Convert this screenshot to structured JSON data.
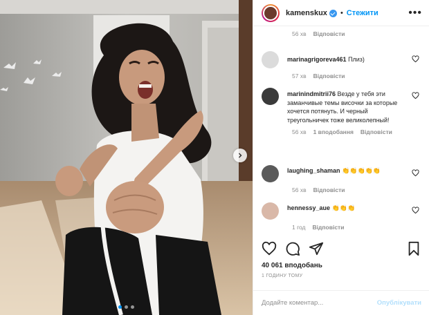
{
  "header": {
    "username": "kamenskux",
    "separator": "•",
    "follow_label": "Стежити",
    "more_label": "•••"
  },
  "top_meta": {
    "time": "56 хв",
    "reply": "Відповісти"
  },
  "comments": [
    {
      "user": "marinagrigoreva461",
      "text": "Плиз)",
      "time": "57 хв",
      "likes": "",
      "reply": "Відповісти"
    },
    {
      "user": "marinindmitrii76",
      "text": "Везде у тебя эти заманчивые темы височки за которые хочется потянуть. И черный треугольничек тоже великолепный!",
      "time": "56 хв",
      "likes": "1 вподобання",
      "reply": "Відповісти"
    },
    {
      "user": "laughing_shaman",
      "text": "👏👏👏👏👏",
      "time": "56 хв",
      "likes": "",
      "reply": "Відповісти"
    },
    {
      "user": "hennessy_aue",
      "text": "👏👏👏",
      "time": "1 год",
      "likes": "",
      "reply": "Відповісти"
    }
  ],
  "post": {
    "likes": "40 061 вподобань",
    "time_ago": "1 годину тому"
  },
  "add_comment": {
    "placeholder": "Додайте коментар...",
    "post_label": "Опублікувати"
  },
  "colors": {
    "accent": "#0095f6",
    "muted": "#8e8e8e",
    "text": "#262626"
  },
  "icons": [
    "heart-icon",
    "comment-icon",
    "share-icon",
    "bookmark-icon",
    "chevron-right-icon",
    "more-icon",
    "verified-icon"
  ],
  "carousel": {
    "slides": 3,
    "active": 1
  }
}
